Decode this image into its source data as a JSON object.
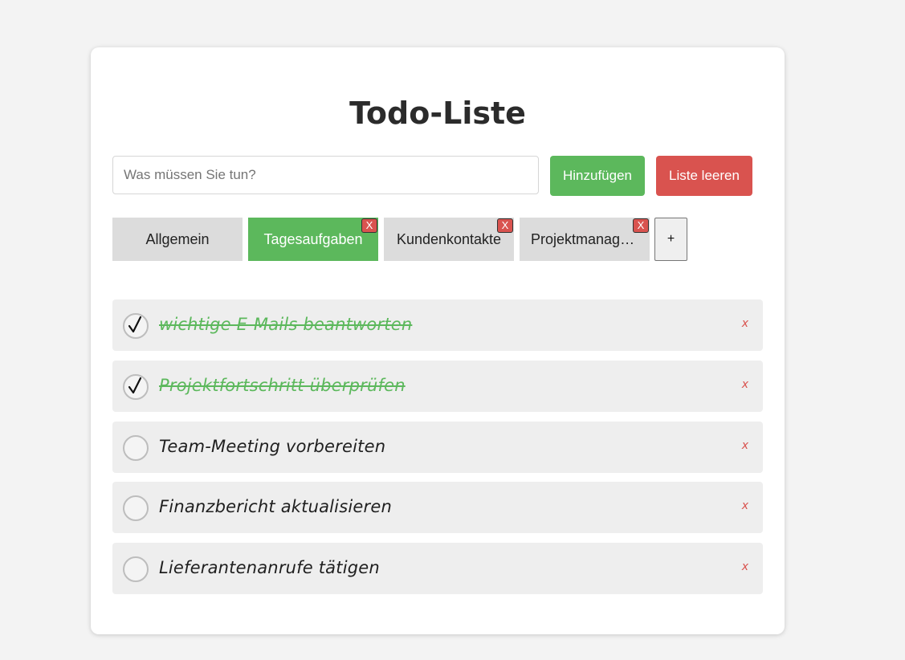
{
  "app": {
    "title": "Todo-Liste"
  },
  "input": {
    "placeholder": "Was müssen Sie tun?",
    "value": ""
  },
  "buttons": {
    "add_label": "Hinzufügen",
    "clear_label": "Liste leeren",
    "add_tab_label": "+",
    "tab_close_label": "X",
    "todo_delete_label": "x"
  },
  "tabs": [
    {
      "label": "Allgemein",
      "active": false,
      "closable": false
    },
    {
      "label": "Tagesaufgaben",
      "active": true,
      "closable": true
    },
    {
      "label": "Kundenkontakte",
      "active": false,
      "closable": true
    },
    {
      "label": "Projektmanagement",
      "active": false,
      "closable": true
    }
  ],
  "todos": [
    {
      "text": "wichtige E-Mails beantworten",
      "done": true
    },
    {
      "text": "Projektfortschritt überprüfen",
      "done": true
    },
    {
      "text": "Team-Meeting vorbereiten",
      "done": false
    },
    {
      "text": "Finanzbericht aktualisieren",
      "done": false
    },
    {
      "text": "Lieferantenanrufe tätigen",
      "done": false
    }
  ],
  "colors": {
    "background": "#f3f3f3",
    "card": "#ffffff",
    "accent_green": "#5cb85c",
    "accent_red": "#d9534f",
    "tab_inactive": "#dcdcdc",
    "item_background": "#eeeeee"
  },
  "icons": {
    "checkmark": "checkmark-icon",
    "close": "close-icon",
    "add": "plus-icon"
  }
}
